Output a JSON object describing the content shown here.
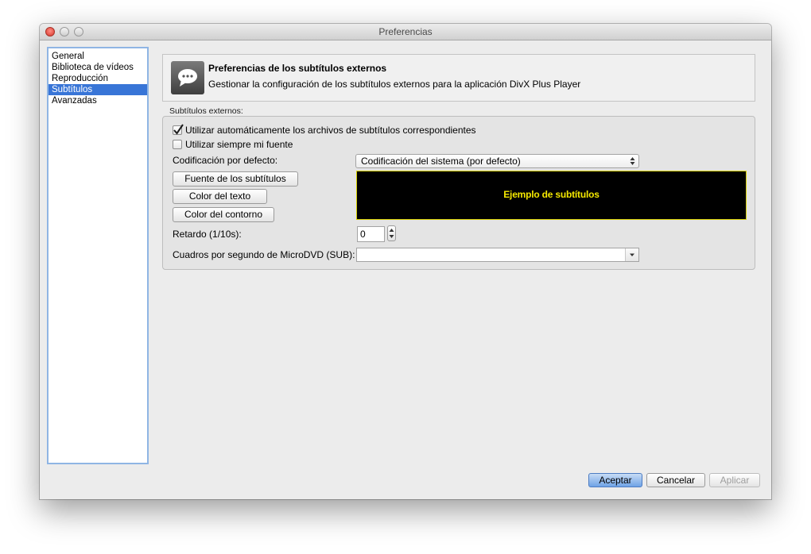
{
  "window": {
    "title": "Preferencias"
  },
  "sidebar": {
    "items": [
      {
        "label": "General"
      },
      {
        "label": "Biblioteca de vídeos"
      },
      {
        "label": "Reproducción"
      },
      {
        "label": "Subtítulos",
        "selected": true
      },
      {
        "label": "Avanzadas"
      }
    ]
  },
  "header": {
    "icon": "speech-bubble-icon",
    "title": "Preferencias de los subtítulos externos",
    "subtitle": "Gestionar la configuración de los subtítulos externos para la aplicación DivX Plus Player"
  },
  "group": {
    "label": "Subtítulos externos:",
    "auto_load": {
      "label": "Utilizar automáticamente los archivos de subtítulos correspondientes",
      "checked": true
    },
    "always_font": {
      "label": "Utilizar siempre mi fuente",
      "checked": false
    },
    "encoding_label": "Codificación por defecto:",
    "encoding_value": "Codificación del sistema (por defecto)",
    "font_button": "Fuente de los subtítulos",
    "text_color_button": "Color del texto",
    "outline_color_button": "Color del contorno",
    "preview_text": "Ejemplo de subtítulos",
    "delay_label": "Retardo (1/10s):",
    "delay_value": "0",
    "fps_label": "Cuadros por segundo de MicroDVD (SUB):",
    "fps_value": ""
  },
  "footer": {
    "ok": "Aceptar",
    "cancel": "Cancelar",
    "apply": "Aplicar"
  },
  "colors": {
    "selection": "#3875d7",
    "preview_bg": "#000000",
    "preview_text": "#f5e800"
  }
}
